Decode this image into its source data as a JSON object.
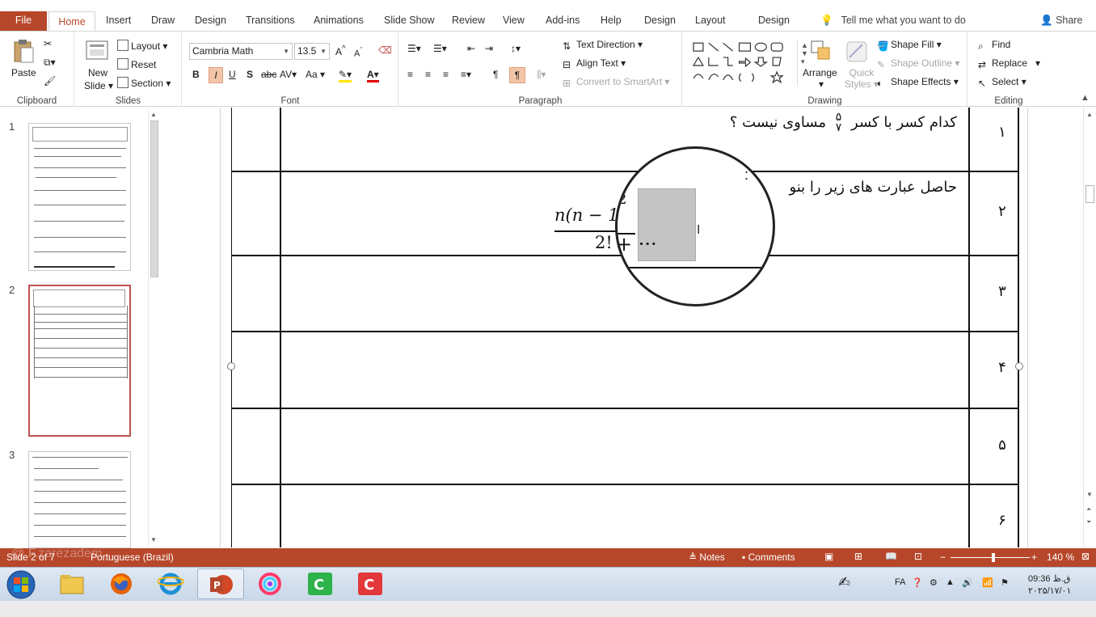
{
  "tabs": [
    "File",
    "Home",
    "Insert",
    "Draw",
    "Design",
    "Transitions",
    "Animations",
    "Slide Show",
    "Review",
    "View",
    "Add-ins",
    "Help",
    "Design",
    "Layout",
    "Design"
  ],
  "tell_me": "Tell me what you want to do",
  "share": "Share",
  "ribbon": {
    "clipboard": {
      "label": "Clipboard",
      "paste": "Paste"
    },
    "slides": {
      "label": "Slides",
      "new_slide_1": "New",
      "new_slide_2": "Slide",
      "layout": "Layout",
      "reset": "Reset",
      "section": "Section"
    },
    "font": {
      "label": "Font",
      "font_name": "Cambria Math",
      "font_size": "13.5",
      "bold": "B",
      "italic": "I",
      "underline": "U",
      "shadow": "S",
      "strike": "abc",
      "case": "Aa"
    },
    "paragraph": {
      "label": "Paragraph",
      "text_direction": "Text Direction",
      "align_text": "Align Text",
      "convert_smartart": "Convert to SmartArt"
    },
    "drawing": {
      "label": "Drawing",
      "arrange": "Arrange",
      "quick_styles_1": "Quick",
      "quick_styles_2": "Styles",
      "shape_fill": "Shape Fill",
      "shape_outline": "Shape Outline",
      "shape_effects": "Shape Effects"
    },
    "editing": {
      "label": "Editing",
      "find": "Find",
      "replace": "Replace",
      "select": "Select"
    }
  },
  "thumbnails": [
    {
      "num": "1"
    },
    {
      "num": "2"
    },
    {
      "num": "3"
    }
  ],
  "slide": {
    "row_numbers": [
      "۱",
      "۲",
      "۳",
      "۴",
      "۵",
      "۶"
    ],
    "q1_text": "کدام کسر با کسر",
    "q1_frac_num": "۵",
    "q1_frac_den": "۷",
    "q1_tail": "مساوی نیست ؟",
    "q2_text": "حاصل عبارت های زیر را بنو",
    "math_num": "n(n − 1)",
    "math_den": "2!",
    "math_sup": "2",
    "math_plus": "+ ···"
  },
  "status": {
    "slide_info": "Slide 2 of 7",
    "watermark": "@ F.zarezadem",
    "language": "Portuguese (Brazil)",
    "notes": "Notes",
    "comments": "Comments",
    "zoom": "140 %"
  },
  "tray": {
    "lang": "FA",
    "time": "09:36 ق.ظ",
    "date": "۲۰۲۵/۱۷/۰۱"
  },
  "colors": {
    "accent": "#b7472a",
    "status_bar": "#b7472a"
  }
}
